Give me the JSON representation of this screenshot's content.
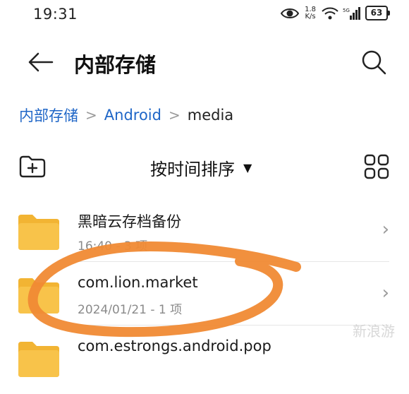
{
  "status_bar": {
    "time": "19:31",
    "speed_value": "1.8",
    "speed_unit": "K/s",
    "battery": "63",
    "icons": [
      "eye-icon",
      "wifi-icon",
      "signal-5g-icon"
    ]
  },
  "header": {
    "title": "内部存储",
    "back_icon": "arrow-left-icon",
    "search_icon": "search-icon"
  },
  "breadcrumb": {
    "items": [
      "内部存储",
      "Android",
      "media"
    ],
    "separator": ">"
  },
  "toolbar": {
    "new_folder_icon": "new-folder-icon",
    "sort_label": "按时间排序",
    "sort_caret": "▼",
    "view_icon": "grid-view-icon"
  },
  "files": [
    {
      "name": "黑暗云存档备份",
      "meta": "16:40 - 3 项",
      "icon": "folder-icon"
    },
    {
      "name": "com.lion.market",
      "meta": "2024/01/21 - 1 项",
      "icon": "folder-icon"
    },
    {
      "name": "com.estrongs.android.pop",
      "meta": "",
      "icon": "folder-icon"
    }
  ],
  "colors": {
    "accent": "#1f66c7",
    "folder": "#f8c34a",
    "folder_tab": "#f2b433",
    "annotation_stroke": "#f08a34"
  }
}
